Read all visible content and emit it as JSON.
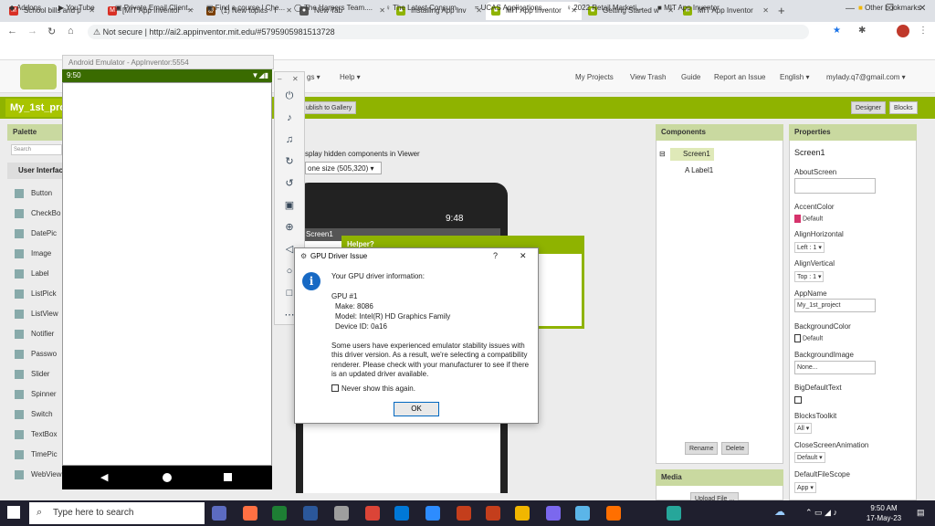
{
  "browser": {
    "tabs": [
      {
        "label": "School bills and p",
        "fav": "M",
        "color": "#d93025"
      },
      {
        "label": "[MIT App Inventor",
        "fav": "M",
        "color": "#d93025"
      },
      {
        "label": "(1) New topics - I",
        "fav": "@",
        "color": "#7b3f00"
      },
      {
        "label": "New Tab",
        "fav": "●",
        "color": "#555"
      },
      {
        "label": "Installing App Inv",
        "fav": "■",
        "color": "#8fb300"
      },
      {
        "label": "MIT App Inventor",
        "fav": "■",
        "color": "#8fb300"
      },
      {
        "label": "Getting Started w",
        "fav": "■",
        "color": "#8fb300"
      },
      {
        "label": "MIT App Inventor",
        "fav": "■",
        "color": "#8fb300"
      }
    ],
    "security": "Not secure",
    "url": "http://ai2.appinventor.mit.edu/#5795905981513728",
    "bookmarks": [
      "Addons",
      "YouTube",
      "Private Email Client...",
      "Find a course | Che...",
      "The Harpers Team....",
      "The Latest Consum...",
      "UCAS Applications...",
      "2022 Retail Marketi...",
      "MIT App Inventor"
    ],
    "other_bookmarks": "Other bookmarks"
  },
  "app": {
    "nav": [
      "gs ▾",
      "Help ▾",
      "My Projects",
      "View Trash",
      "Guide",
      "Report an Issue",
      "English ▾",
      "mylady.q7@gmail.com ▾"
    ],
    "project_name": "My_1st_pro",
    "publish_label": "ublish to Gallery",
    "designer_label": "Designer",
    "blocks_label": "Blocks",
    "palette_header": "Palette",
    "search_placeholder": "Search Components",
    "palette_section": "User Interface",
    "palette_items": [
      "Button",
      "CheckBo",
      "DatePic",
      "Image",
      "Label",
      "ListPick",
      "ListView",
      "Notifier",
      "Passwo",
      "Slider",
      "Spinner",
      "Switch",
      "TextBox",
      "TimePic",
      "WebView"
    ],
    "viewer_checkbox": "splay hidden components in Viewer",
    "viewer_size": "one size (505,320) ▾",
    "components_header": "Components",
    "comp_screen": "Screen1",
    "comp_label": "Label1",
    "rename_label": "Rename",
    "delete_label": "Delete",
    "media_header": "Media",
    "upload_label": "Upload File ...",
    "properties_header": "Properties",
    "prop_screen": "Screen1",
    "props": [
      {
        "name": "AboutScreen",
        "value": ""
      },
      {
        "name": "AccentColor",
        "value": "Default"
      },
      {
        "name": "AlignHorizontal",
        "value": "Left : 1 ▾"
      },
      {
        "name": "AlignVertical",
        "value": "Top : 1 ▾"
      },
      {
        "name": "AppName",
        "value": "My_1st_project"
      },
      {
        "name": "BackgroundColor",
        "value": "Default"
      },
      {
        "name": "BackgroundImage",
        "value": "None..."
      },
      {
        "name": "BigDefaultText",
        "value": ""
      },
      {
        "name": "BlocksToolkit",
        "value": "All ▾"
      },
      {
        "name": "CloseScreenAnimation",
        "value": "Default ▾"
      },
      {
        "name": "DefaultFileScope",
        "value": "App ▾"
      }
    ],
    "phone_time": "9:48",
    "phone_screen_label": "Screen1",
    "helper_label": "Helper?"
  },
  "emulator": {
    "title": "Android Emulator - AppInventor:5554",
    "status_time": "9:50",
    "tools": [
      "⏻",
      "♪",
      "♫",
      "↻",
      "↺",
      "▣",
      "⊕",
      "◁",
      "○",
      "□",
      "⋯"
    ]
  },
  "dialog": {
    "title": "GPU Driver Issue",
    "help": "?",
    "close": "✕",
    "intro": "Your GPU driver information:",
    "gpu": "GPU #1",
    "make": "Make: 8086",
    "model": "Model: Intel(R) HD Graphics Family",
    "device": "Device ID: 0a16",
    "msg1": "Some users have experienced emulator stability issues with",
    "msg2": "this driver version.  As a result, we're selecting a compatibility",
    "msg3": "renderer.  Please check with your manufacturer to see if there",
    "msg4": "is an updated driver available.",
    "never": "Never show this again.",
    "ok": "OK"
  },
  "taskbar": {
    "search": "Type here to search",
    "time": "9:50 AM",
    "date": "17-May-23",
    "icons": [
      "#5c6bc0",
      "#ff7043",
      "#1e7e34",
      "#2b579a",
      "#9e9e9e",
      "#db4437",
      "#0078d7",
      "#2d8cff",
      "#c43e1c",
      "#c43e1c",
      "#f1b600",
      "#7b68ee",
      "#5bb5e8",
      "#ff6f00",
      "#26a69a"
    ]
  }
}
